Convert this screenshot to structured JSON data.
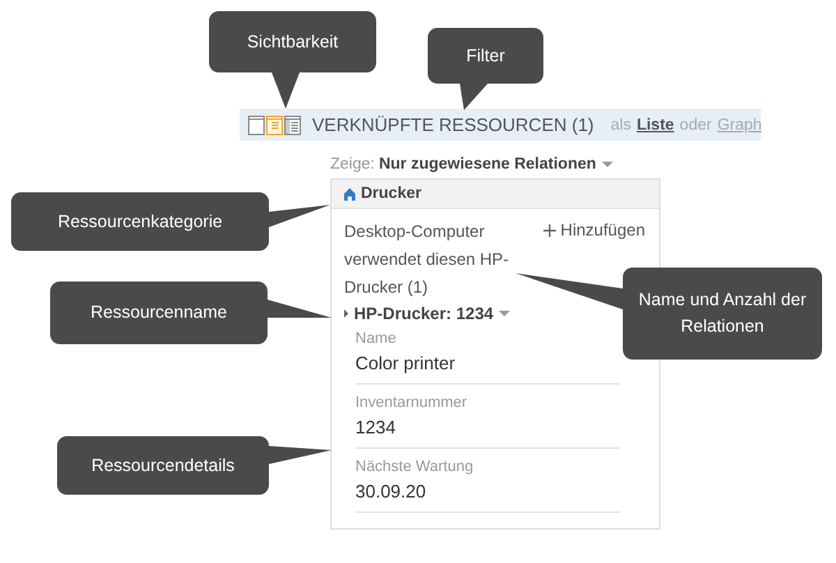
{
  "view_modes": [
    {
      "kind": "collapsed",
      "selected": false
    },
    {
      "kind": "compact",
      "selected": true
    },
    {
      "kind": "full",
      "selected": false
    }
  ],
  "section": {
    "title": "VERKNÜPFTE RESSOURCEN (1)",
    "prefix": "als",
    "separator": "oder",
    "display_options": [
      {
        "label": "Liste",
        "selected": true
      },
      {
        "label": "Graph",
        "selected": false
      }
    ]
  },
  "filter": {
    "label": "Zeige:",
    "value": "Nur zugewiesene Relationen"
  },
  "card": {
    "category": "Drucker",
    "relation": "Desktop-Computer verwendet diesen HP-Drucker (1)",
    "add_button": "Hinzufügen",
    "resource": {
      "name": "HP-Drucker: 1234",
      "expanded": true,
      "fields": [
        {
          "label": "Name",
          "value": "Color printer"
        },
        {
          "label": "Inventarnummer",
          "value": "1234"
        },
        {
          "label": "Nächste Wartung",
          "value": "30.09.20"
        }
      ]
    }
  },
  "callouts": [
    {
      "text": "Sichtbarkeit"
    },
    {
      "text": "Filter"
    },
    {
      "text": "Ressourcenkategorie"
    },
    {
      "text": "Ressourcenname"
    },
    {
      "text": "Name und Anzahl der Relationen"
    },
    {
      "text": "Ressourcendetails"
    }
  ]
}
